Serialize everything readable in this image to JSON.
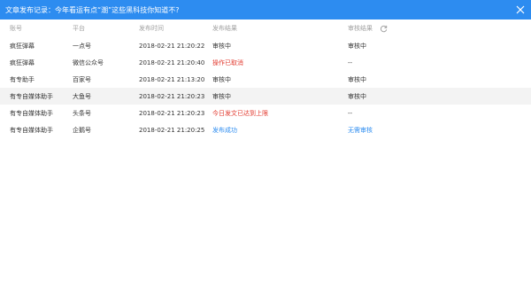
{
  "window": {
    "title": "文章发布记录：今年看运有点“潮”这些黑科技你知道不?"
  },
  "table": {
    "columns": [
      "账号",
      "平台",
      "发布时间",
      "发布结果",
      "审核结果"
    ],
    "rows": [
      {
        "account": "疯狂弹幕",
        "platform": "一点号",
        "time": "2018-02-21 21:20:22",
        "result": "审核中",
        "review": "审核中",
        "result_color": "#333333",
        "review_color": "#333333"
      },
      {
        "account": "疯狂弹幕",
        "platform": "微信公众号",
        "time": "2018-02-21 21:20:40",
        "result": "操作已取消",
        "review": "--",
        "result_color": "#e23a2f",
        "review_color": "#333333"
      },
      {
        "account": "有专助手",
        "platform": "百家号",
        "time": "2018-02-21 21:13:20",
        "result": "审核中",
        "review": "审核中",
        "result_color": "#333333",
        "review_color": "#333333"
      },
      {
        "account": "有专自媒体助手",
        "platform": "大鱼号",
        "time": "2018-02-21 21:20:23",
        "result": "审核中",
        "review": "审核中",
        "result_color": "#333333",
        "review_color": "#333333"
      },
      {
        "account": "有专自媒体助手",
        "platform": "头条号",
        "time": "2018-02-21 21:20:23",
        "result": "今日发文已达到上限",
        "review": "--",
        "result_color": "#e23a2f",
        "review_color": "#333333"
      },
      {
        "account": "有专自媒体助手",
        "platform": "企鹅号",
        "time": "2018-02-21 21:20:25",
        "result": "发布成功",
        "review": "无需审核",
        "result_color": "#2d8cf0",
        "review_color": "#2d8cf0"
      }
    ]
  },
  "colors": {
    "titlebar": "#2d8cf0",
    "error": "#e23a2f",
    "success": "#2d8cf0",
    "highlight_row": "#f3f3f3"
  },
  "icons": {
    "close": "close-icon",
    "refresh": "refresh-icon"
  }
}
